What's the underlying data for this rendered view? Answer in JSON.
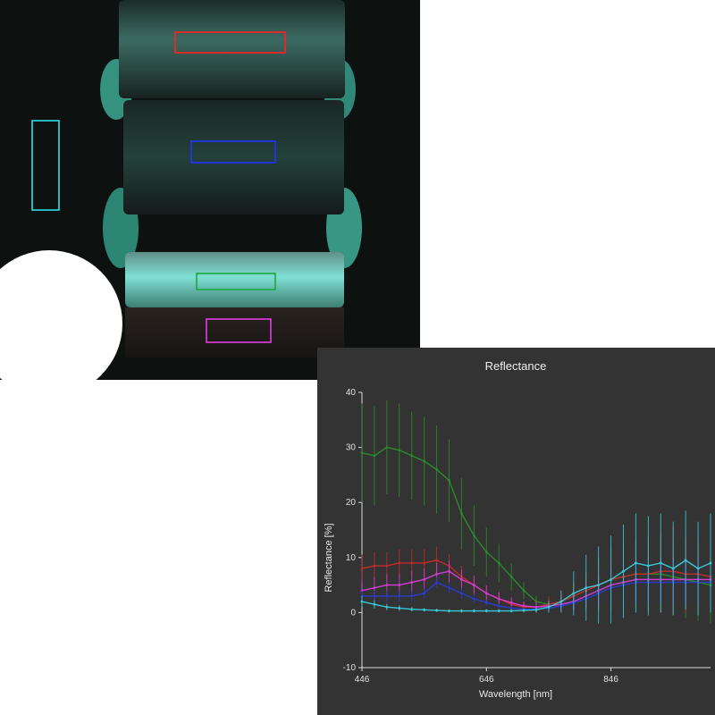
{
  "image": {
    "roi_colors": [
      "#ff2020",
      "#2233ff",
      "#1ea83c",
      "#e23ce2",
      "#2ee0e8"
    ]
  },
  "chart_data": {
    "type": "line",
    "title": "Reflectance",
    "xlabel": "Wavelength [nm]",
    "ylabel": "Reflectance [%]",
    "xlim": [
      446,
      1006
    ],
    "ylim": [
      -10,
      40
    ],
    "xticks": [
      446,
      646,
      846
    ],
    "yticks": [
      -10,
      0,
      10,
      20,
      30,
      40
    ],
    "grid": false,
    "error_bars": true,
    "series": [
      {
        "color": "#2a8a2a",
        "x": [
          446,
          466,
          486,
          506,
          526,
          546,
          566,
          586,
          606,
          626,
          646,
          666,
          686,
          706,
          726,
          746,
          766,
          786,
          806,
          826,
          846,
          866,
          886,
          906,
          926,
          946,
          966,
          986,
          1006
        ],
        "y": [
          29,
          28.5,
          30,
          29.5,
          28.5,
          27.5,
          26,
          24,
          18,
          14,
          11,
          9,
          6.5,
          4,
          2,
          1.5,
          2,
          3,
          4,
          5,
          6,
          6.5,
          7,
          7,
          7,
          6.5,
          6,
          5.5,
          5
        ],
        "err": [
          9,
          9,
          8.5,
          8.5,
          8,
          8,
          8,
          7.5,
          6.5,
          5.5,
          4.5,
          3.5,
          2.5,
          1.5,
          1,
          1,
          1.5,
          2.5,
          3.5,
          5,
          6,
          6.5,
          6.5,
          7,
          7,
          7,
          7,
          7,
          7
        ]
      },
      {
        "color": "#c42a2a",
        "x": [
          446,
          466,
          486,
          506,
          526,
          546,
          566,
          586,
          606,
          626,
          646,
          666,
          686,
          706,
          726,
          746,
          766,
          786,
          806,
          826,
          846,
          866,
          886,
          906,
          926,
          946,
          966,
          986,
          1006
        ],
        "y": [
          8,
          8.5,
          8.5,
          9,
          9,
          9,
          9.5,
          8.5,
          6.5,
          5,
          3.5,
          2.5,
          1.5,
          1,
          1,
          1.5,
          2,
          3,
          4,
          5,
          6,
          6.5,
          7,
          7,
          7.5,
          7.5,
          7,
          7,
          6.5
        ],
        "err": [
          2.5,
          2.5,
          2.5,
          2.5,
          2.5,
          2.5,
          2.5,
          2.2,
          2,
          1.8,
          1.5,
          1.2,
          1,
          1,
          1.2,
          1.5,
          2,
          2.5,
          3,
          4,
          5,
          5.5,
          6,
          6.5,
          7.5,
          8,
          7,
          6.5,
          6
        ]
      },
      {
        "color": "#d23cd2",
        "x": [
          446,
          466,
          486,
          506,
          526,
          546,
          566,
          586,
          606,
          626,
          646,
          666,
          686,
          706,
          726,
          746,
          766,
          786,
          806,
          826,
          846,
          866,
          886,
          906,
          926,
          946,
          966,
          986,
          1006
        ],
        "y": [
          4,
          4.5,
          5,
          5,
          5.5,
          6,
          7,
          7.5,
          6,
          5,
          3.5,
          2.5,
          1.8,
          1.2,
          1,
          1.2,
          1.5,
          2,
          3,
          4,
          5,
          5.5,
          6,
          6,
          6,
          6,
          6,
          6,
          6
        ],
        "err": [
          2,
          2,
          2,
          2,
          2,
          2,
          2,
          2,
          1.8,
          1.6,
          1.4,
          1.2,
          1,
          0.8,
          0.8,
          1,
          1.2,
          1.5,
          2,
          2.5,
          3,
          3.5,
          4,
          4,
          4,
          4,
          4,
          4,
          4
        ]
      },
      {
        "color": "#2a3acc",
        "x": [
          446,
          466,
          486,
          506,
          526,
          546,
          566,
          586,
          606,
          626,
          646,
          666,
          686,
          706,
          726,
          746,
          766,
          786,
          806,
          826,
          846,
          866,
          886,
          906,
          926,
          946,
          966,
          986,
          1006
        ],
        "y": [
          3,
          3,
          3,
          3,
          3,
          3.5,
          5.5,
          4.5,
          3.5,
          2.5,
          1.8,
          1.2,
          0.8,
          0.6,
          0.6,
          0.8,
          1.2,
          1.8,
          2.5,
          3.5,
          4.5,
          5,
          5.5,
          5.5,
          5.5,
          5.5,
          5.5,
          5.5,
          5.5
        ],
        "err": [
          1,
          1,
          1,
          1,
          1,
          1,
          1,
          1,
          1,
          0.8,
          0.6,
          0.5,
          0.4,
          0.4,
          0.4,
          0.5,
          0.6,
          0.8,
          1.2,
          2,
          3,
          3.5,
          4,
          4,
          4,
          4,
          4,
          4,
          4
        ]
      },
      {
        "color": "#3ac8d8",
        "x": [
          446,
          466,
          486,
          506,
          526,
          546,
          566,
          586,
          606,
          626,
          646,
          666,
          686,
          706,
          726,
          746,
          766,
          786,
          806,
          826,
          846,
          866,
          886,
          906,
          926,
          946,
          966,
          986,
          1006
        ],
        "y": [
          2,
          1.5,
          1,
          0.8,
          0.6,
          0.5,
          0.4,
          0.3,
          0.3,
          0.3,
          0.3,
          0.3,
          0.3,
          0.4,
          0.5,
          1,
          2,
          3.5,
          4.5,
          5,
          6,
          7.5,
          9,
          8.5,
          9,
          8,
          9.5,
          8,
          9
        ],
        "err": [
          1,
          0.8,
          0.6,
          0.5,
          0.4,
          0.3,
          0.3,
          0.3,
          0.3,
          0.3,
          0.3,
          0.3,
          0.3,
          0.3,
          0.5,
          1,
          2,
          4,
          6,
          7,
          8,
          8.5,
          9,
          9,
          9,
          8.5,
          9,
          8.5,
          9
        ]
      }
    ]
  }
}
